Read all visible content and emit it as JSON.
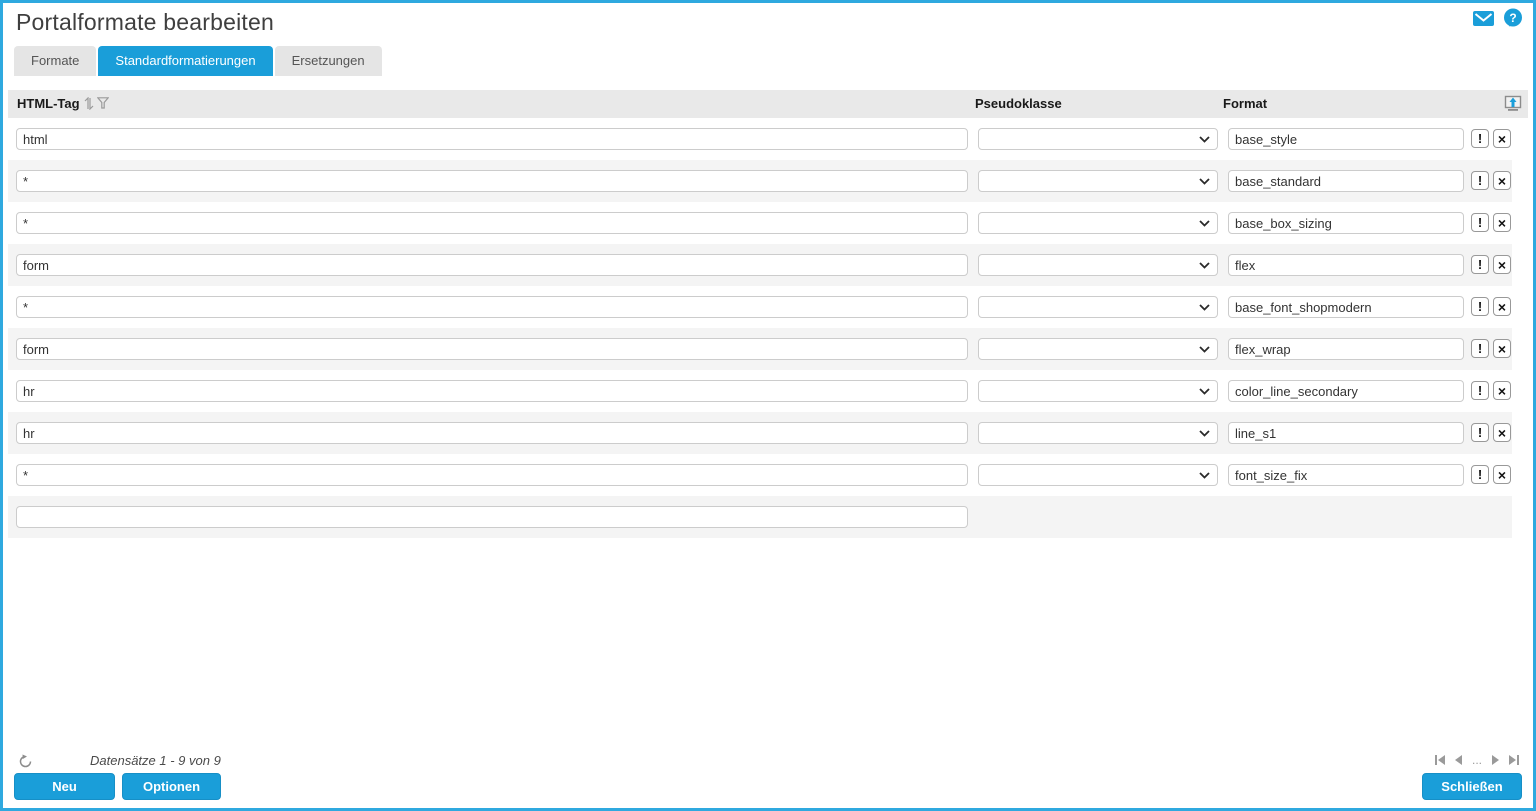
{
  "page": {
    "title": "Portalformate bearbeiten"
  },
  "icons": {
    "mail": "mail-icon",
    "help": "help-icon",
    "help_glyph": "?",
    "sort": "sort-icon",
    "filter": "filter-icon",
    "export": "export-icon",
    "refresh": "refresh-icon",
    "chevron": "chevron-down-icon"
  },
  "tabs": [
    {
      "label": "Formate",
      "active": false
    },
    {
      "label": "Standardformatierungen",
      "active": true
    },
    {
      "label": "Ersetzungen",
      "active": false
    }
  ],
  "table": {
    "headers": {
      "html_tag": "HTML-Tag",
      "pseudoklasse": "Pseudoklasse",
      "format": "Format"
    },
    "rows": [
      {
        "html_tag": "html",
        "pseudoklasse": "",
        "format": "base_style"
      },
      {
        "html_tag": "*",
        "pseudoklasse": "",
        "format": "base_standard"
      },
      {
        "html_tag": "*",
        "pseudoklasse": "",
        "format": "base_box_sizing"
      },
      {
        "html_tag": "form",
        "pseudoklasse": "",
        "format": "flex"
      },
      {
        "html_tag": "*",
        "pseudoklasse": "",
        "format": "base_font_shopmodern"
      },
      {
        "html_tag": "form",
        "pseudoklasse": "",
        "format": "flex_wrap"
      },
      {
        "html_tag": "hr",
        "pseudoklasse": "",
        "format": "color_line_secondary"
      },
      {
        "html_tag": "hr",
        "pseudoklasse": "",
        "format": "line_s1"
      },
      {
        "html_tag": "*",
        "pseudoklasse": "",
        "format": "font_size_fix"
      }
    ],
    "new_row_value": "",
    "row_actions": {
      "apply_label": "!",
      "delete_label": "×"
    }
  },
  "footer": {
    "records_label": "Datensätze 1 - 9 von 9",
    "pagination_ellipsis": "...",
    "buttons": {
      "new": "Neu",
      "options": "Optionen",
      "close": "Schließen"
    }
  },
  "colors": {
    "accent": "#1a9ed9",
    "frame_border": "#2fa9df",
    "header_bg": "#e9e9e9",
    "row_stripe": "#f4f4f4",
    "tab_inactive_bg": "#e5e5e5"
  }
}
